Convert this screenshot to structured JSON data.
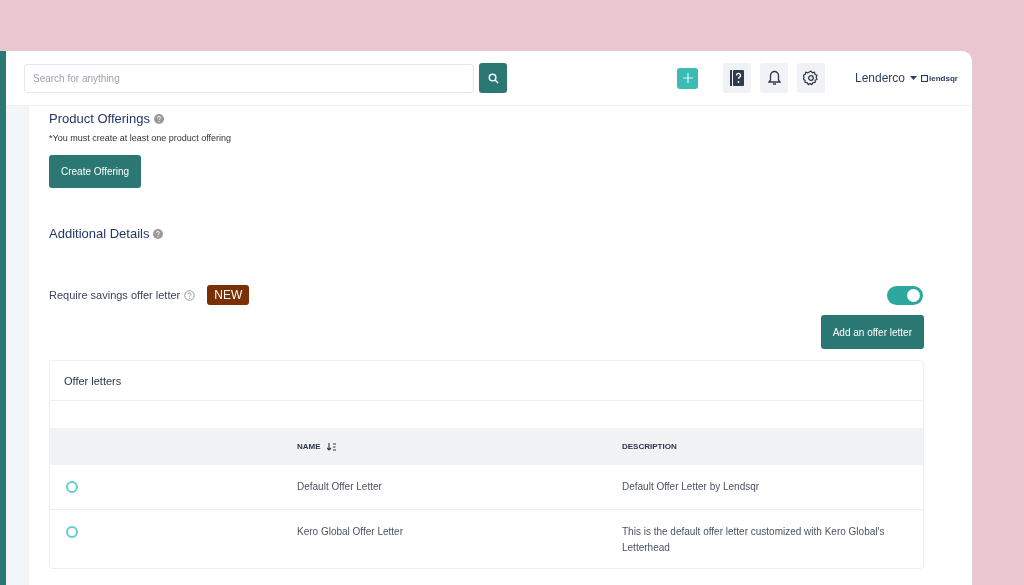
{
  "header": {
    "search": {
      "placeholder": "Search for anything"
    },
    "user": "Lenderco",
    "logo": "lendsqr"
  },
  "product_offerings": {
    "title": "Product Offerings",
    "note": "*You must create at least one product offering",
    "button": "Create Offering"
  },
  "additional_details": {
    "title": "Additional Details"
  },
  "offer_letter_setting": {
    "label": "Require savings offer letter",
    "badge": "NEW",
    "on": true,
    "button": "Add an offer letter"
  },
  "offer_letters": {
    "title": "Offer letters",
    "columns": [
      "NAME",
      "DESCRIPTION"
    ],
    "rows": [
      {
        "selected": false,
        "name": "Default Offer Letter",
        "description": "Default Offer Letter by Lendsqr"
      },
      {
        "selected": false,
        "name": "Kero Global Offer Letter",
        "description": "This is the default offer letter customized with Kero Global's Letterhead"
      }
    ]
  }
}
